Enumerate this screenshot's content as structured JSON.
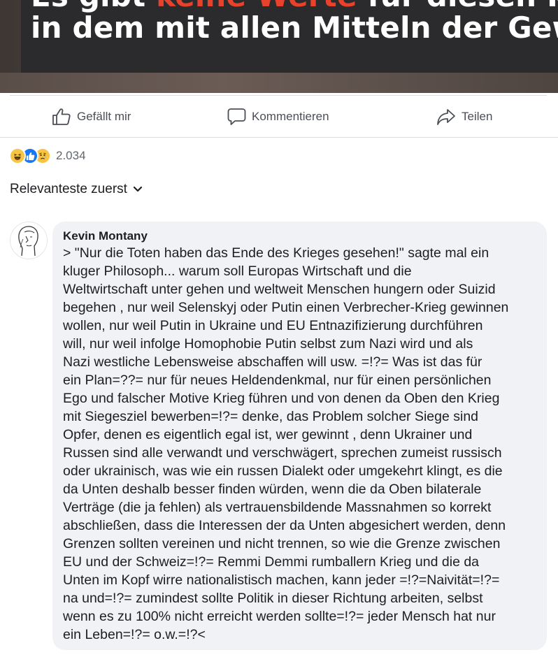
{
  "post_image": {
    "line1_prefix": "Es gibt ",
    "line1_highlight": "keine Werte",
    "line1_suffix": " für diesen Krieg,",
    "line2": "in dem mit allen Mitteln der Gewalt"
  },
  "actions": {
    "like_label": "Gefällt mir",
    "comment_label": "Kommentieren",
    "share_label": "Teilen"
  },
  "reactions": {
    "icons": [
      "haha-icon",
      "like-icon",
      "sad-icon"
    ],
    "count": "2.034"
  },
  "sort": {
    "label": "Relevanteste zuerst"
  },
  "comment": {
    "author": "Kevin Montany",
    "lines": [
      "> \"Nur die Toten haben das Ende des Krieges gesehen!\" sagte mal ein",
      "kluger Philosoph... warum soll Europas Wirtschaft und die",
      "Weltwirtschaft unter gehen und weltweit Menschen hungern oder Suizid",
      "begehen , nur weil Selenskyj oder Putin einen Verbrecher-Krieg gewinnen",
      "wollen, nur weil Putin in Ukraine und EU  Entnazifizierung durchführen",
      "will, nur weil infolge Homophobie Putin selbst zum Nazi wird und als",
      "Nazi  westliche Lebensweise abschaffen will usw. =!?= Was ist das für",
      "ein Plan=??= nur für neues Heldendenkmal, nur für einen persönlichen",
      "Ego und falscher Motive Krieg führen und von denen da Oben den Krieg",
      "mit Siegesziel bewerben=!?= denke, das Problem solcher Siege sind",
      "Opfer, denen es eigentlich egal ist, wer gewinnt , denn Ukrainer und",
      "Russen sind alle verwandt und verschwägert, sprechen zumeist russisch",
      "oder ukrainisch, was wie ein russen Dialekt oder umgekehrt klingt, es die",
      "da Unten deshalb besser finden würden, wenn die da Oben bilaterale",
      "Verträge (die ja fehlen) als vertrauensbildende Massnahmen so korrekt",
      "abschließen, dass die Interessen der da Unten abgesichert werden, denn",
      "Grenzen sollten vereinen und nicht trennen, so wie die Grenze zwischen",
      "EU und der Schweiz=!?= Remmi Demmi rumballern Krieg und die da",
      "Unten im Kopf wirre nationalistisch machen, kann jeder =!?=Naivität=!?=",
      "na und=!?= zumindest sollte Politik in dieser Richtung arbeiten, selbst",
      "wenn es zu 100% nicht erreicht werden sollte=!?= jeder Mensch hat nur",
      "ein Leben=!?= o.w.=!?<"
    ]
  },
  "colors": {
    "highlight_red": "#e8412c",
    "like_blue": "#1877f2",
    "bubble_bg": "#f0f2f5",
    "action_text": "#4b4f56"
  }
}
